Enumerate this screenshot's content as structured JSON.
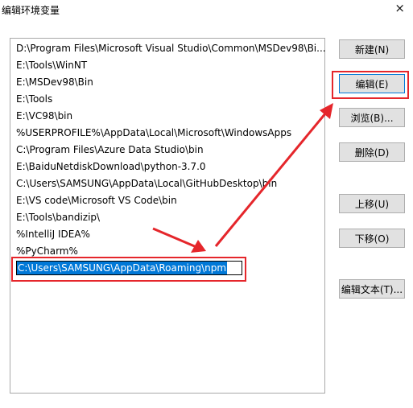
{
  "window": {
    "title": "编辑环境变量",
    "close_icon": "×"
  },
  "path_list": {
    "items": [
      "D:\\Program Files\\Microsoft Visual Studio\\Common\\MSDev98\\Bi...",
      "E:\\Tools\\WinNT",
      "E:\\MSDev98\\Bin",
      "E:\\Tools",
      "E:\\VC98\\bin",
      "%USERPROFILE%\\AppData\\Local\\Microsoft\\WindowsApps",
      "C:\\Program Files\\Azure Data Studio\\bin",
      "E:\\BaiduNetdiskDownload\\python-3.7.0",
      "C:\\Users\\SAMSUNG\\AppData\\Local\\GitHubDesktop\\bin",
      "E:\\VS code\\Microsoft VS Code\\bin",
      "E:\\Tools\\bandizip\\",
      "%IntelliJ IDEA%",
      "%PyCharm%"
    ],
    "editing_value": "C:\\Users\\SAMSUNG\\AppData\\Roaming\\npm"
  },
  "buttons": {
    "new": "新建(N)",
    "edit": "编辑(E)",
    "browse": "浏览(B)...",
    "delete": "删除(D)",
    "move_up": "上移(U)",
    "move_down": "下移(O)",
    "edit_text": "编辑文本(T)..."
  },
  "annotation": {
    "color": "#e5262b"
  }
}
